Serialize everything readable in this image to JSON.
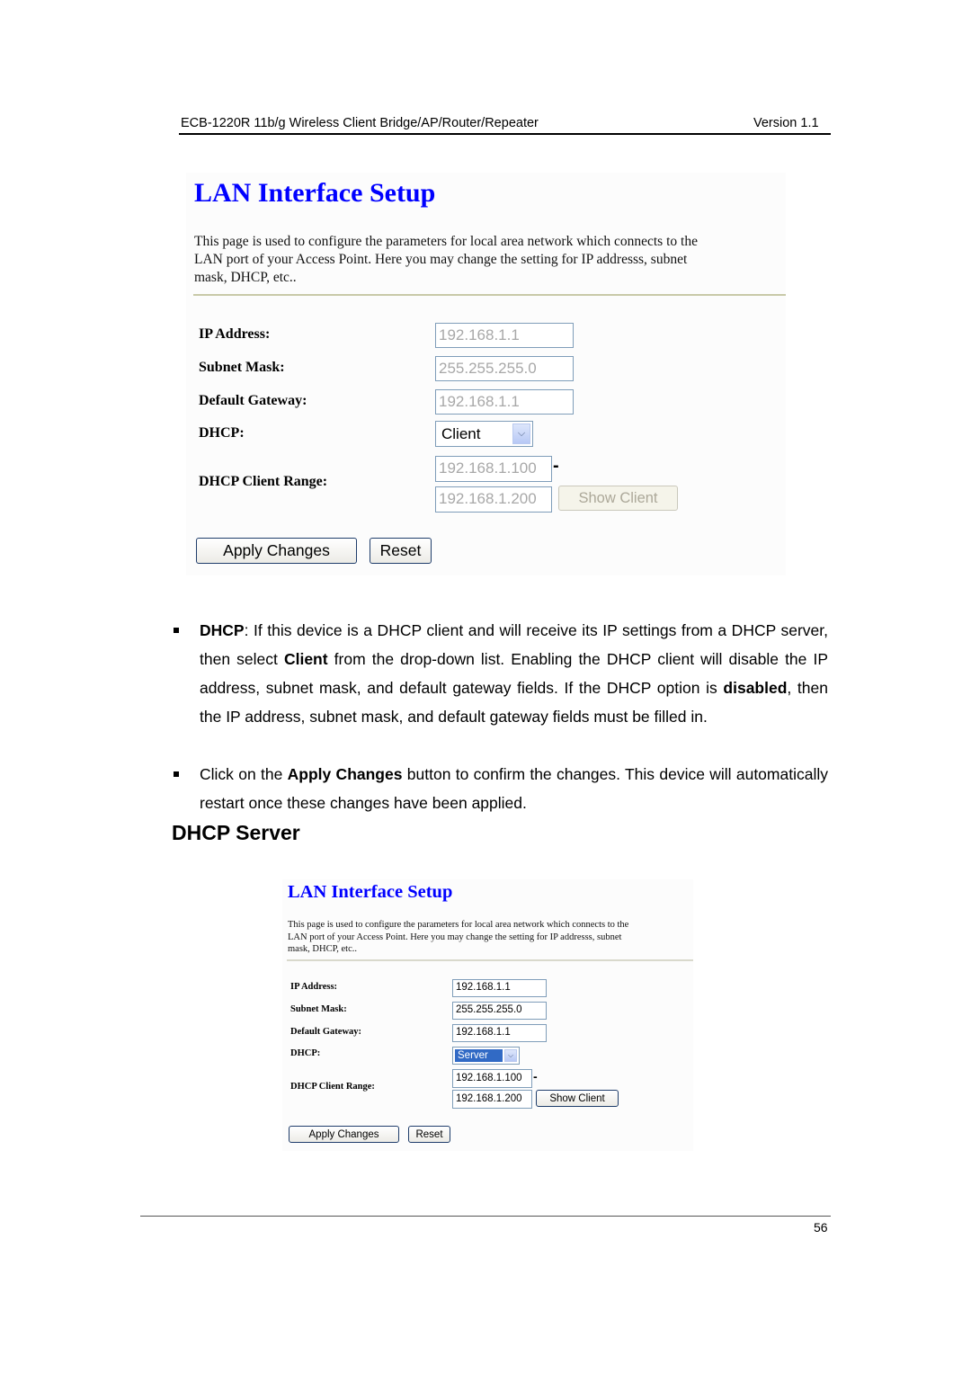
{
  "page_header": {
    "title": "ECB-1220R 11b/g Wireless Client Bridge/AP/Router/Repeater",
    "version": "Version 1.1"
  },
  "screenshot_client": {
    "title": "LAN Interface Setup",
    "description_lines": [
      "This page is used to configure the parameters for local area network which connects to the",
      "LAN port of your Access Point. Here you may change the setting for IP addresss, subnet",
      "mask, DHCP, etc.."
    ],
    "ip_address_label": "IP Address:",
    "ip_address_value": "192.168.1.1",
    "subnet_mask_label": "Subnet Mask:",
    "subnet_mask_value": "255.255.255.0",
    "default_gateway_label": "Default Gateway:",
    "default_gateway_value": "192.168.1.1",
    "dhcp_label": "DHCP:",
    "dhcp_selected": "Client",
    "dhcp_range_label": "DHCP Client Range:",
    "dhcp_range_start": "192.168.1.100",
    "dhcp_range_end": "192.168.1.200",
    "range_separator": "-",
    "show_client_label": "Show Client",
    "apply_label": "Apply Changes",
    "reset_label": "Reset"
  },
  "bullets": [
    {
      "segments": [
        {
          "text": "DHCP",
          "bold": true
        },
        {
          "text": ": If this device is a DHCP client and will receive its IP settings from a DHCP server, then select ",
          "bold": false
        },
        {
          "text": "Client",
          "bold": true
        },
        {
          "text": " from the drop-down list. Enabling the DHCP client will disable the IP address, subnet mask, and default gateway fields. If the DHCP option is ",
          "bold": false
        },
        {
          "text": "disabled",
          "bold": true
        },
        {
          "text": ", then the IP address, subnet mask, and default gateway fields must be filled in.",
          "bold": false
        }
      ]
    },
    {
      "segments": [
        {
          "text": "Click on the ",
          "bold": false
        },
        {
          "text": "Apply Changes",
          "bold": true
        },
        {
          "text": " button to confirm the changes. This device will automatically restart once these changes have been applied.",
          "bold": false
        }
      ]
    }
  ],
  "section_heading": "DHCP Server",
  "screenshot_server": {
    "title": "LAN Interface Setup",
    "description_lines": [
      "This page is used to configure the parameters for local area network which connects to the",
      "LAN port of your Access Point. Here you may change the setting for IP addresss, subnet",
      "mask, DHCP, etc.."
    ],
    "ip_address_label": "IP Address:",
    "ip_address_value": "192.168.1.1",
    "subnet_mask_label": "Subnet Mask:",
    "subnet_mask_value": "255.255.255.0",
    "default_gateway_label": "Default Gateway:",
    "default_gateway_value": "192.168.1.1",
    "dhcp_label": "DHCP:",
    "dhcp_selected": "Server",
    "dhcp_range_label": "DHCP Client Range:",
    "dhcp_range_start": "192.168.1.100",
    "dhcp_range_end": "192.168.1.200",
    "range_separator": "-",
    "show_client_label": "Show Client",
    "apply_label": "Apply Changes",
    "reset_label": "Reset"
  },
  "page_number": "56",
  "colors": {
    "title_blue": "#0000ff",
    "field_border": "#7f9db9",
    "selection_blue": "#316ac5"
  }
}
